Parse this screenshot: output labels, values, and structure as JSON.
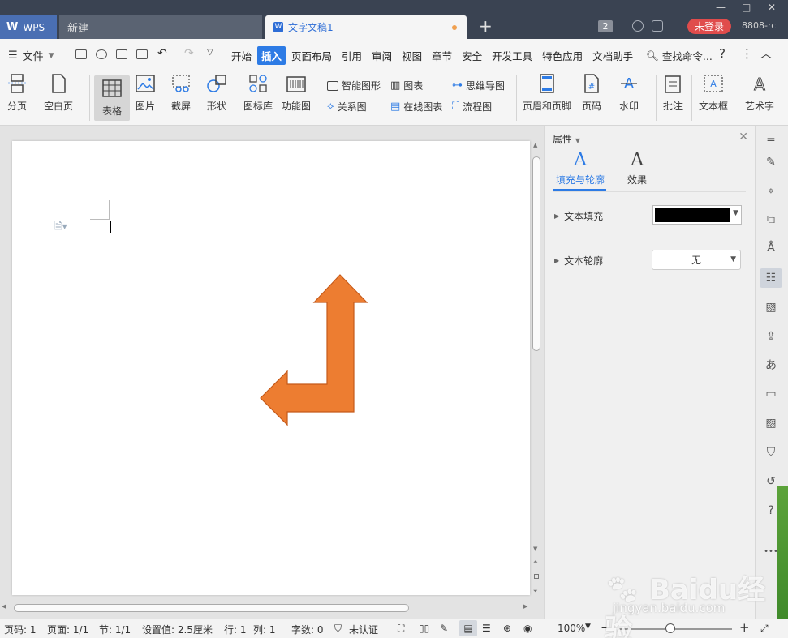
{
  "titlebar": {
    "wps_tab": "WPS",
    "new_tab": "新建",
    "doc_tab": "文字文稿1",
    "badge_count": "2",
    "login_label": "未登录",
    "user_id": "8808-rc"
  },
  "menubar": {
    "file_label": "文件",
    "tabs": [
      "开始",
      "插入",
      "页面布局",
      "引用",
      "审阅",
      "视图",
      "章节",
      "安全",
      "开发工具",
      "特色应用",
      "文档助手"
    ],
    "active_tab": "插入",
    "search_label": "查找命令..."
  },
  "ribbon": {
    "page_break": "分页",
    "blank_page": "空白页",
    "table": "表格",
    "picture": "图片",
    "screenshot": "截屏",
    "shape": "形状",
    "icon_library": "图标库",
    "function_chart": "功能图",
    "smart_shape": "智能图形",
    "chart": "图表",
    "mind_map": "思维导图",
    "relation_chart": "关系图",
    "online_chart": "在线图表",
    "flowchart": "流程图",
    "header_footer": "页眉和页脚",
    "page_number": "页码",
    "watermark": "水印",
    "comment": "批注",
    "text_box": "文本框",
    "word_art": "艺术字"
  },
  "properties": {
    "title": "属性",
    "tab_fill_outline": "填充与轮廓",
    "tab_effect": "效果",
    "text_fill_label": "文本填充",
    "text_fill_color": "#000000",
    "text_outline_label": "文本轮廓",
    "text_outline_value": "无"
  },
  "shape": {
    "fill_color": "#ed7d31",
    "stroke_color": "#c55a1a"
  },
  "statusbar": {
    "page_num": "页码: 1",
    "page_total": "页面: 1/1",
    "section": "节: 1/1",
    "setting": "设置值: 2.5厘米",
    "row": "行: 1",
    "col": "列: 1",
    "word_count": "字数: 0",
    "cert": "未认证",
    "zoom": "100%",
    "zoom_level": 0.46
  },
  "watermark": {
    "brand": "Baidu经验",
    "url": "jingyan.baidu.com"
  }
}
